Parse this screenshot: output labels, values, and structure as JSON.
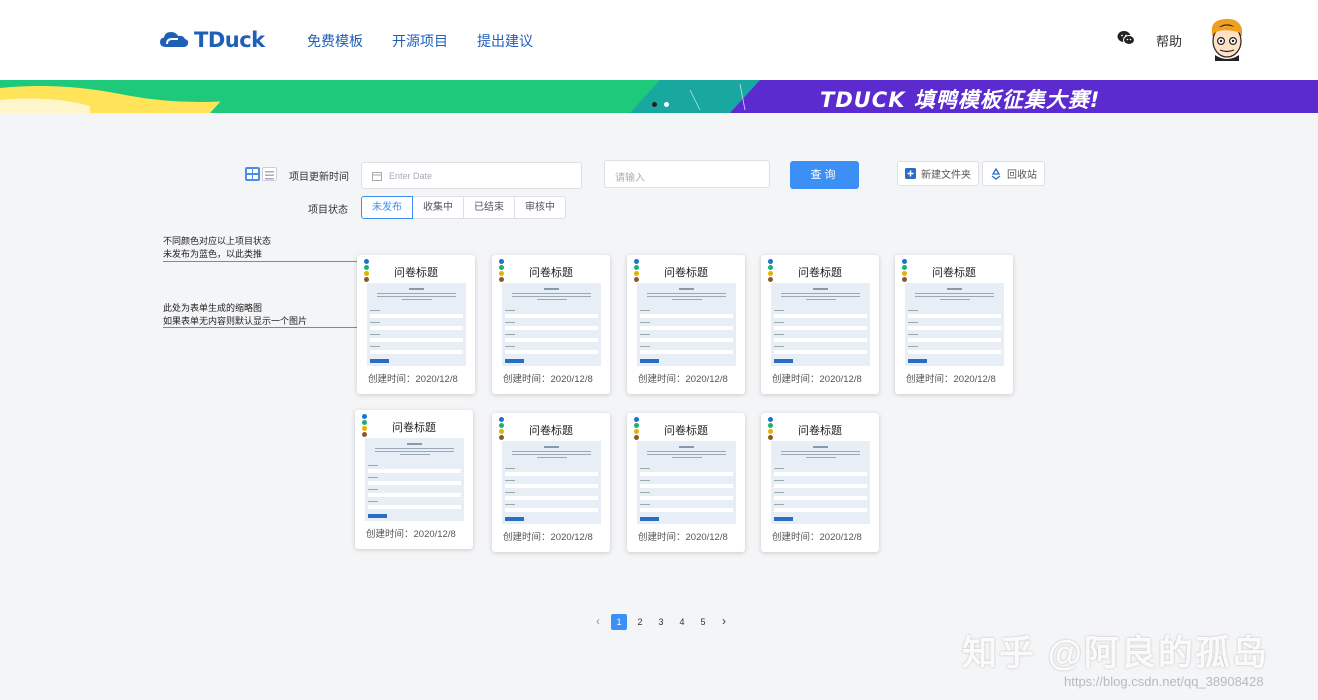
{
  "header": {
    "logo_text": "TDuck",
    "nav": [
      "免费模板",
      "开源项目",
      "提出建议"
    ],
    "help_label": "帮助",
    "wechat_icon": "wechat-icon",
    "avatar_icon": "avatar-icon"
  },
  "banner": {
    "title": "TDUCK 填鸭模板征集大赛!",
    "active_dot": 0,
    "dots": 2
  },
  "filters": {
    "update_time_label": "项目更新时间",
    "date_placeholder": "Enter Date",
    "search_placeholder": "请输入",
    "query_button": "查询",
    "new_folder_button": "新建文件夹",
    "recycle_button": "回收站",
    "status_label": "项目状态",
    "status_options": [
      "未发布",
      "收集中",
      "已结束",
      "审核中"
    ],
    "status_selected": "未发布"
  },
  "annotations": {
    "color_note_line1": "不同颜色对应以上项目状态",
    "color_note_line2": "未发布为蓝色，以此类推",
    "thumb_note_line1": "此处为表单生成的缩略图",
    "thumb_note_line2": "如果表单无内容则默认显示一个图片"
  },
  "cards": [
    {
      "title": "问卷标题",
      "date": "创建时间：2020/12/8"
    },
    {
      "title": "问卷标题",
      "date": "创建时间：2020/12/8"
    },
    {
      "title": "问卷标题",
      "date": "创建时间：2020/12/8"
    },
    {
      "title": "问卷标题",
      "date": "创建时间：2020/12/8"
    },
    {
      "title": "问卷标题",
      "date": "创建时间：2020/12/8"
    },
    {
      "title": "问卷标题",
      "date": "创建时间：2020/12/8"
    },
    {
      "title": "问卷标题",
      "date": "创建时间：2020/12/8"
    },
    {
      "title": "问卷标题",
      "date": "创建时间：2020/12/8"
    },
    {
      "title": "问卷标题",
      "date": "创建时间：2020/12/8"
    }
  ],
  "status_colors": [
    "#1f6fd6",
    "#19b36b",
    "#e0b400",
    "#8a5a2b"
  ],
  "pagination": {
    "pages": [
      "1",
      "2",
      "3",
      "4",
      "5"
    ],
    "current": "1"
  },
  "watermark": {
    "text": "知乎 @阿良的孤岛",
    "url": "https://blog.csdn.net/qq_38908428"
  }
}
